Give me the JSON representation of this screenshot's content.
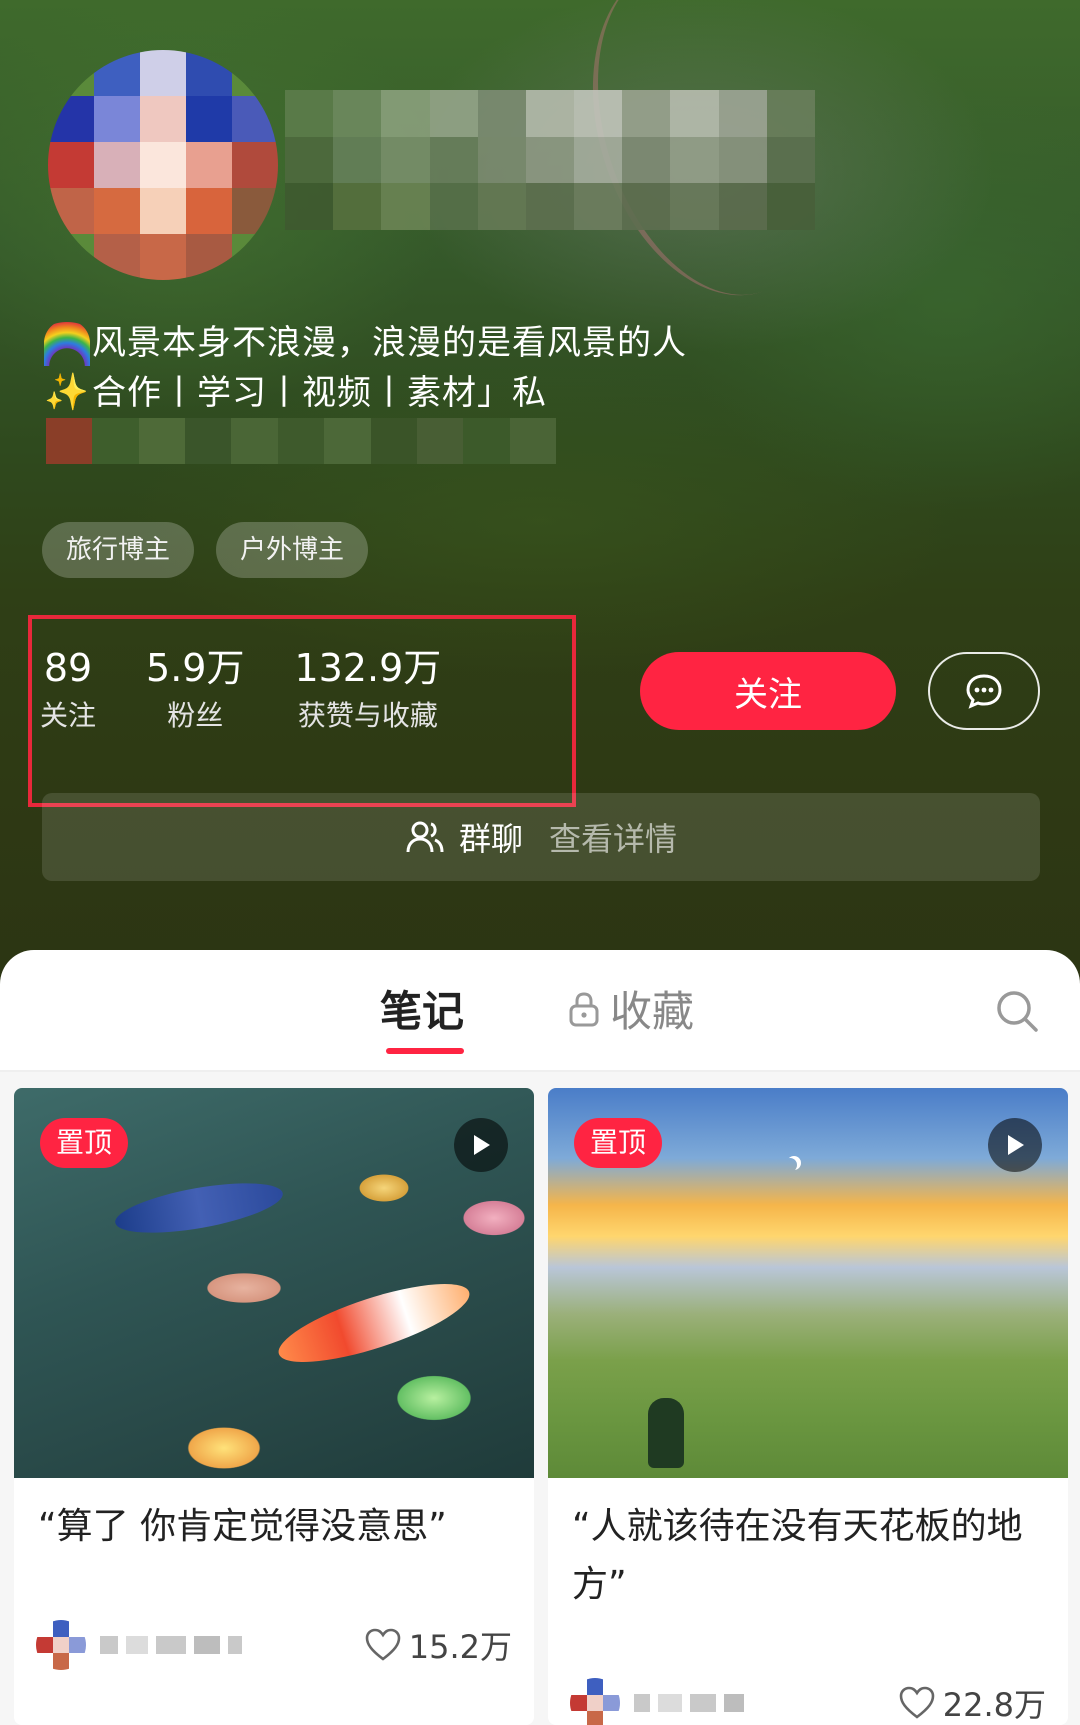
{
  "profile": {
    "bio_line1": "风景本身不浪漫，浪漫的是看风景的人",
    "bio_line2": "合作丨学习丨视频丨素材」私",
    "tags": [
      "旅行博主",
      "户外博主"
    ],
    "stats": [
      {
        "value": "89",
        "label": "关注"
      },
      {
        "value": "5.9万",
        "label": "粉丝"
      },
      {
        "value": "132.9万",
        "label": "获赞与收藏"
      }
    ],
    "follow_label": "关注",
    "group": {
      "label": "群聊",
      "detail": "查看详情"
    }
  },
  "tabs": {
    "notes": "笔记",
    "collect": "收藏"
  },
  "posts": [
    {
      "badge": "置顶",
      "title": "“算了 你肯定觉得没意思”",
      "likes": "15.2万"
    },
    {
      "badge": "置顶",
      "title": "“人就该待在没有天花板的地方”",
      "likes": "22.8万"
    }
  ],
  "colors": {
    "accent": "#ff2442",
    "highlight_border": "#e8283b"
  },
  "icons": [
    "chat-icon",
    "group-icon",
    "lock-icon",
    "search-icon",
    "play-icon",
    "heart-icon"
  ]
}
